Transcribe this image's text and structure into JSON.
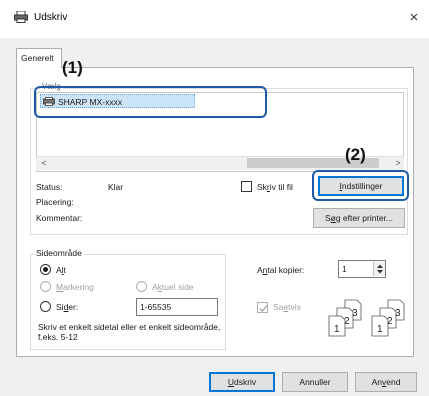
{
  "window": {
    "title": "Udskriv",
    "close_glyph": "×"
  },
  "tabs": [
    {
      "label": "Generelt",
      "active": true
    }
  ],
  "printer_group": {
    "label": "Vælg",
    "selected_printer": "SHARP MX-xxxx",
    "scroll_left": "<",
    "scroll_right": ">"
  },
  "callouts": {
    "one": "(1)",
    "two": "(2)"
  },
  "status": {
    "status_label": "Status:",
    "status_value": "Klar",
    "location_label": "Placering:",
    "comment_label": "Kommentar:"
  },
  "print_to_file": {
    "label_pre": "Sk",
    "label_u": "r",
    "label_post": "iv til fil",
    "checked": false
  },
  "buttons": {
    "settings": {
      "pre": "",
      "u": "I",
      "post": "ndstillinger"
    },
    "find_printer": {
      "pre": "S",
      "u": "ø",
      "post": "g efter printer..."
    },
    "print": {
      "pre": "",
      "u": "U",
      "post": "dskriv"
    },
    "cancel": "Annuller",
    "apply": {
      "pre": "An",
      "u": "v",
      "post": "end"
    }
  },
  "page_range": {
    "label": "Sideområde",
    "all": {
      "pre": "A",
      "u": "l",
      "post": "t",
      "selected": true
    },
    "selection": {
      "pre": "",
      "u": "M",
      "post": "arkering",
      "enabled": false
    },
    "current_page": {
      "pre": "A",
      "u": "k",
      "post": "tuel side",
      "enabled": false
    },
    "pages": {
      "pre": "Si",
      "u": "d",
      "post": "er:",
      "value": "1-65535"
    },
    "hint": "Skriv et enkelt sidetal eller et enkelt sideområde, f.eks. 5-12"
  },
  "copies": {
    "label_pre": "A",
    "label_u": "n",
    "label_post": "tal kopier:",
    "value": "1",
    "collate": {
      "pre": "Sa",
      "u": "e",
      "post": "tvis",
      "checked": true,
      "enabled": false
    },
    "collate_stack_numbers": [
      "1",
      "2",
      "3"
    ]
  },
  "colors": {
    "accent": "#1f5aa6",
    "selection_bg": "#cce4f7",
    "focus": "#0078d7"
  }
}
